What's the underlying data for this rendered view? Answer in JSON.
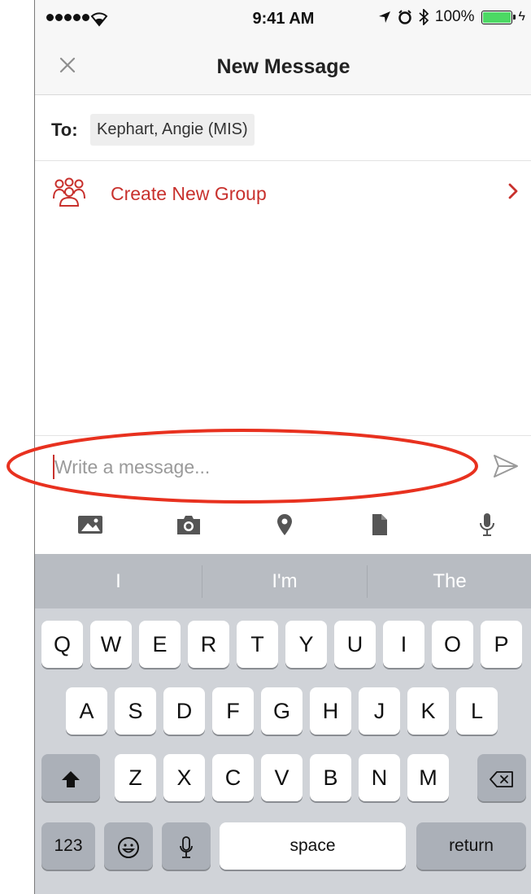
{
  "status_bar": {
    "time": "9:41 AM",
    "battery_percent": "100%"
  },
  "navbar": {
    "title": "New Message"
  },
  "recipient": {
    "label": "To:",
    "name": "Kephart, Angie (MIS)"
  },
  "group": {
    "label": "Create New Group"
  },
  "composer": {
    "placeholder": "Write a message..."
  },
  "attachments": [
    "image-icon",
    "camera-icon",
    "location-pin-icon",
    "document-icon",
    "microphone-icon"
  ],
  "keyboard": {
    "suggestions": [
      "I",
      "I'm",
      "The"
    ],
    "row1": [
      "Q",
      "W",
      "E",
      "R",
      "T",
      "Y",
      "U",
      "I",
      "O",
      "P"
    ],
    "row2": [
      "A",
      "S",
      "D",
      "F",
      "G",
      "H",
      "J",
      "K",
      "L"
    ],
    "row3": [
      "Z",
      "X",
      "C",
      "V",
      "B",
      "N",
      "M"
    ],
    "numbers_label": "123",
    "space_label": "space",
    "return_label": "return"
  },
  "colors": {
    "accent": "#c8312d",
    "battery": "#4cd964",
    "keyboard_bg": "#d0d3d8"
  }
}
